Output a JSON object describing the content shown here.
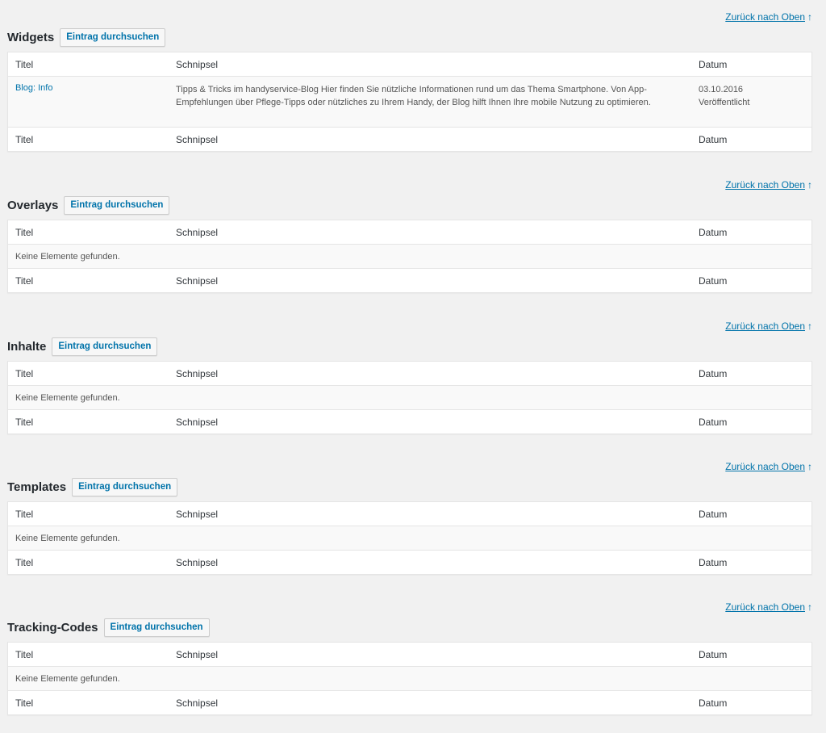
{
  "columns": {
    "title": "Titel",
    "snippet": "Schnipsel",
    "date": "Datum"
  },
  "back_to_top": "Zurück nach Oben",
  "back_to_top_arrow": "↑",
  "browse_label": "Eintrag durchsuchen",
  "empty_text": "Keine Elemente gefunden.",
  "sections": [
    {
      "title": "Widgets",
      "entries": [
        {
          "title": "Blog: Info",
          "snippet": "Tipps & Tricks im handyservice-Blog Hier finden Sie nützliche Informationen rund um das Thema Smartphone. Von App-Empfehlungen über Pflege-Tipps oder nützliches zu Ihrem Handy, der Blog hilft Ihnen Ihre mobile Nutzung zu optimieren.",
          "date": "03.10.2016",
          "status": "Veröffentlicht"
        }
      ]
    },
    {
      "title": "Overlays",
      "entries": []
    },
    {
      "title": "Inhalte",
      "entries": []
    },
    {
      "title": "Templates",
      "entries": []
    },
    {
      "title": "Tracking-Codes",
      "entries": []
    }
  ]
}
